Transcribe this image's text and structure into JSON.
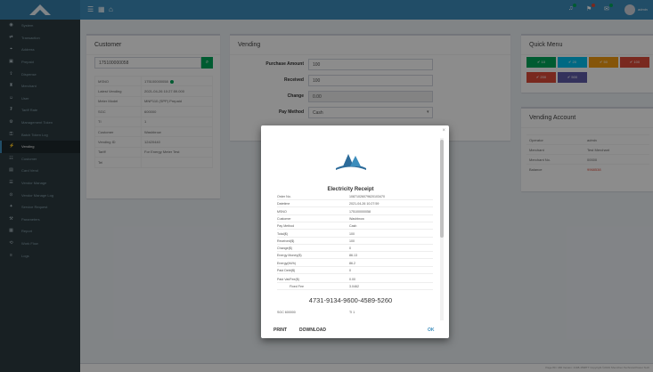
{
  "header": {
    "icons": [
      "menu-icon",
      "grid-icon",
      "home-icon"
    ],
    "notifications": [
      "bell-icon",
      "flag-icon",
      "cart-icon"
    ],
    "user_name": "admin",
    "accent": "#3c8dbc"
  },
  "sidebar": {
    "items": [
      {
        "icon": "dashboard-icon",
        "label": "System",
        "active": false
      },
      {
        "icon": "transaction-icon",
        "label": "Transaction",
        "active": false
      },
      {
        "icon": "address-icon",
        "label": "Address",
        "active": false
      },
      {
        "icon": "prepaid-icon",
        "label": "Prepaid",
        "active": false
      },
      {
        "icon": "dispense-icon",
        "label": "Dispense",
        "active": false
      },
      {
        "icon": "merchant-icon",
        "label": "Merchant",
        "active": false
      },
      {
        "icon": "user-icon",
        "label": "User",
        "active": false
      },
      {
        "icon": "tariff-icon",
        "label": "Tariff Rate",
        "active": false
      },
      {
        "icon": "management-icon",
        "label": "Management Token",
        "active": false
      },
      {
        "icon": "key-icon",
        "label": "Batch Token Log",
        "active": false
      },
      {
        "icon": "vending-icon",
        "label": "Vending",
        "active": true
      },
      {
        "icon": "customer-icon",
        "label": "Customer",
        "active": false
      },
      {
        "icon": "card-icon",
        "label": "Card Vend",
        "active": false
      },
      {
        "icon": "vendor-icon",
        "label": "Vendor Manage",
        "active": false
      },
      {
        "icon": "token-icon",
        "label": "Vendor Manage Log",
        "active": false
      },
      {
        "icon": "service-icon",
        "label": "Service Request",
        "active": false
      },
      {
        "icon": "settings-icon",
        "label": "Parameters",
        "active": false
      },
      {
        "icon": "report-icon",
        "label": "Report",
        "active": false
      },
      {
        "icon": "tools-icon",
        "label": "Work Flow",
        "active": false
      },
      {
        "icon": "log-icon",
        "label": "Logs",
        "active": false
      }
    ]
  },
  "customer": {
    "title": "Customer",
    "input_value": "175100000058",
    "table": [
      {
        "label": "MSNO",
        "value": "175100000058",
        "status_ok": true
      },
      {
        "label": "Latest Vending",
        "value": "2021-04-26 10:27:59.000",
        "status_ok": false
      },
      {
        "label": "Meter Model",
        "value": "MNP110 (SPP) Prepaid",
        "status_ok": false
      },
      {
        "label": "SGC",
        "value": "600000",
        "status_ok": false
      },
      {
        "label": "TI",
        "value": "1",
        "status_ok": false
      },
      {
        "label": "Customer",
        "value": "Washbrow",
        "status_ok": false
      },
      {
        "label": "Vending ID",
        "value": "12420440",
        "status_ok": false
      },
      {
        "label": "Tariff",
        "value": "For Energy Meter Test",
        "status_ok": false
      },
      {
        "label": "Tel",
        "value": "",
        "status_ok": false
      }
    ]
  },
  "vending": {
    "title": "Vending",
    "fields": [
      {
        "label": "Purchase Amount",
        "value": "100",
        "readonly": false
      },
      {
        "label": "Received",
        "value": "100",
        "readonly": false
      },
      {
        "label": "Change",
        "value": "0.00",
        "readonly": true
      },
      {
        "label": "Pay Method",
        "value": "Cash",
        "readonly": false
      }
    ]
  },
  "quick_menu": {
    "title": "Quick Menu",
    "buttons": [
      {
        "label": "✔ 10",
        "color": "#00a65a"
      },
      {
        "label": "✔ 20",
        "color": "#00c0ef"
      },
      {
        "label": "✔ 50",
        "color": "#f39c12"
      },
      {
        "label": "✔ 100",
        "color": "#dd4b39"
      },
      {
        "label": "✔ 200",
        "color": "#dd4b39"
      },
      {
        "label": "✔ 500",
        "color": "#605ca8"
      }
    ]
  },
  "vending_account": {
    "title": "Vending Account",
    "rows": [
      {
        "label": "Operator",
        "value": "admin",
        "color": "#666"
      },
      {
        "label": "Merchant",
        "value": "Test Merchant",
        "color": "#666"
      },
      {
        "label": "Merchant No.",
        "value": "00000",
        "color": "#666"
      },
      {
        "label": "Balance",
        "value": "9968538",
        "color": "#dd4b39"
      }
    ]
  },
  "receipt": {
    "title": "Electricity Receipt",
    "rows": [
      {
        "key": "Order No.",
        "value": "10871026079620103470"
      },
      {
        "key": "Datetime",
        "value": "2021-04-26 10:27:59"
      },
      {
        "key": "MSNO",
        "value": "175100000058"
      },
      {
        "key": "Customer",
        "value": "Washbrow"
      },
      {
        "key": "Pay Method",
        "value": "Cash"
      },
      {
        "key": "Total($)",
        "value": "100"
      },
      {
        "key": "Received($)",
        "value": "100"
      },
      {
        "key": "Change($)",
        "value": "0"
      },
      {
        "key": "Energy Money($)",
        "value": "86.13"
      },
      {
        "key": "Energy(kWh)",
        "value": "86.2"
      },
      {
        "key": "Paid Debt($)",
        "value": "0"
      },
      {
        "key": "Paid Vat/Fee($)",
        "value": "0.00"
      },
      {
        "key": "Fixed Fee",
        "value": "3.0462"
      }
    ],
    "token": "4731-9134-9600-4589-5260",
    "token_footer_key": "SGC 600000",
    "token_footer_value": "TI 1",
    "buttons": {
      "print": "PRINT",
      "download": "DOWNLOAD",
      "ok": "OK"
    }
  },
  "footer": {
    "text": "Page 80 / 466   Version: 2108-1598TT   Copyright ©2019 Shenzhen Technical Power Tech"
  }
}
